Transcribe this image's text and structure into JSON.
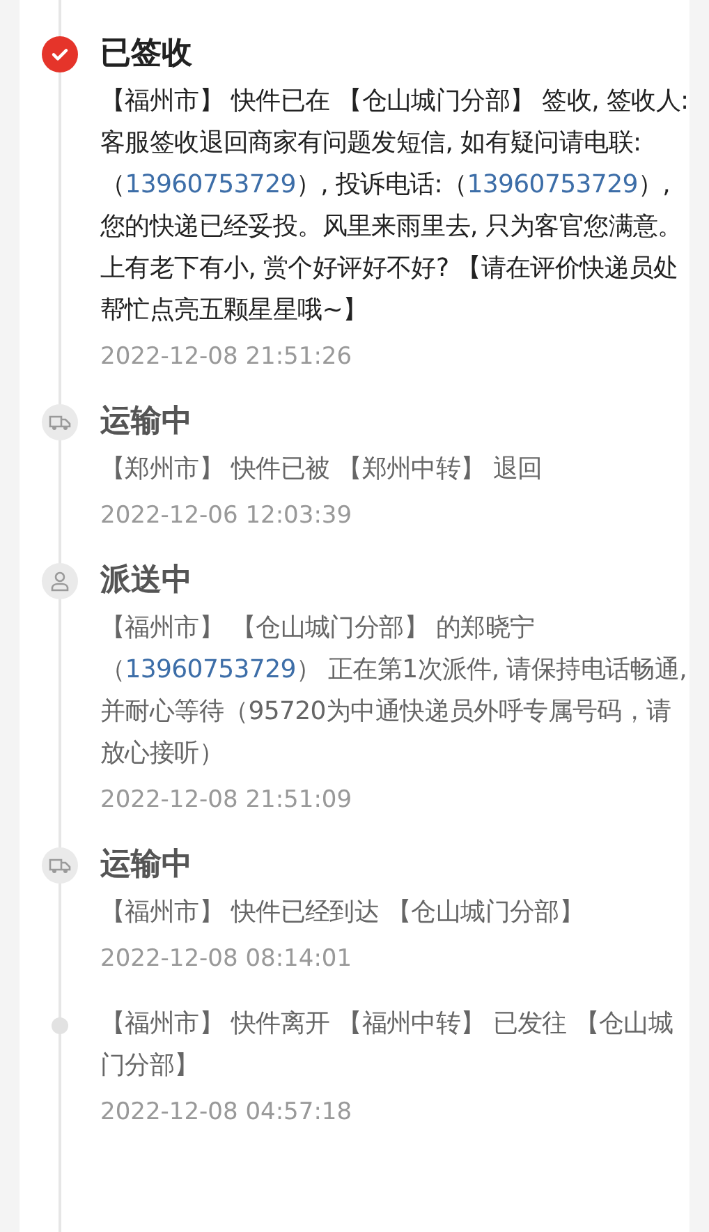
{
  "events": [
    {
      "kind": "signed",
      "current": true,
      "title": "已签收",
      "description": [
        {
          "kind": "text",
          "text": "【福州市】 快件已在 【仓山城门分部】 签收, 签收人: 客服签收退回商家有问题发短信, 如有疑问请电联:（"
        },
        {
          "kind": "phone",
          "text": "13960753729"
        },
        {
          "kind": "text",
          "text": "）, 投诉电话:（"
        },
        {
          "kind": "phone",
          "text": "13960753729"
        },
        {
          "kind": "text",
          "text": "）, 您的快递已经妥投。风里来雨里去, 只为客官您满意。上有老下有小, 赏个好评好不好? 【请在评价快递员处帮忙点亮五颗星星哦~】"
        }
      ],
      "time": "2022-12-08 21:51:26"
    },
    {
      "kind": "transit",
      "current": false,
      "title": "运输中",
      "description": [
        {
          "kind": "text",
          "text": "【郑州市】 快件已被 【郑州中转】 退回"
        }
      ],
      "time": "2022-12-06 12:03:39"
    },
    {
      "kind": "delivering",
      "current": false,
      "title": "派送中",
      "description": [
        {
          "kind": "text",
          "text": "【福州市】 【仓山城门分部】 的郑晓宁（"
        },
        {
          "kind": "phone",
          "text": "13960753729"
        },
        {
          "kind": "text",
          "text": "） 正在第1次派件, 请保持电话畅通,并耐心等待（95720为中通快递员外呼专属号码，请放心接听）"
        }
      ],
      "time": "2022-12-08 21:51:09"
    },
    {
      "kind": "transit",
      "current": false,
      "title": "运输中",
      "description": [
        {
          "kind": "text",
          "text": "【福州市】 快件已经到达 【仓山城门分部】"
        }
      ],
      "time": "2022-12-08 08:14:01"
    },
    {
      "kind": "step",
      "current": false,
      "description": [
        {
          "kind": "text",
          "text": "【福州市】 快件离开 【福州中转】 已发往 【仓山城门分部】"
        }
      ],
      "time": "2022-12-08 04:57:18"
    }
  ]
}
